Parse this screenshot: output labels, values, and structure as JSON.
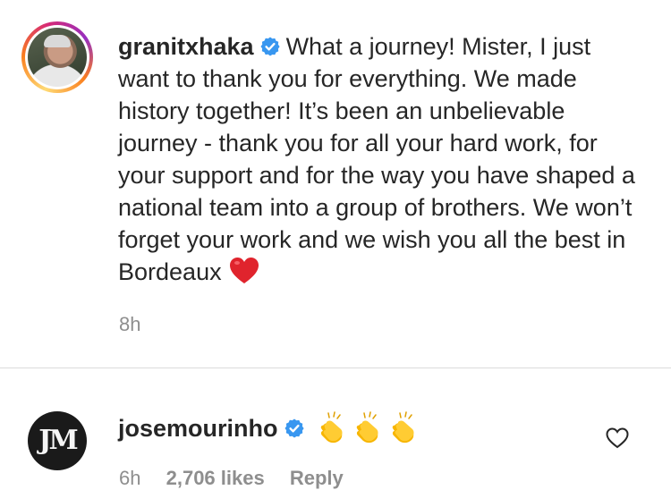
{
  "comment1": {
    "username": "granitxhaka",
    "text": "What a journey! Mister, I just want to thank you for everything. We made history together! It’s been an unbelievable journey - thank you for all your hard work, for your support and for the way you have shaped a national team into a group of brothers. We won’t forget your work and we wish you all the best in Bordeaux",
    "emoji": "red-heart",
    "time": "8h",
    "has_story_ring": true
  },
  "comment2": {
    "username": "josemourinho",
    "avatar_text": "JM",
    "emoji": [
      "clapping-hands",
      "clapping-hands",
      "clapping-hands"
    ],
    "time": "6h",
    "likes": "2,706 likes",
    "reply": "Reply"
  },
  "colors": {
    "verified_blue": "#3897f0",
    "secondary_text": "#8e8e8e",
    "primary_text": "#262626",
    "divider": "#dbdbdb"
  }
}
